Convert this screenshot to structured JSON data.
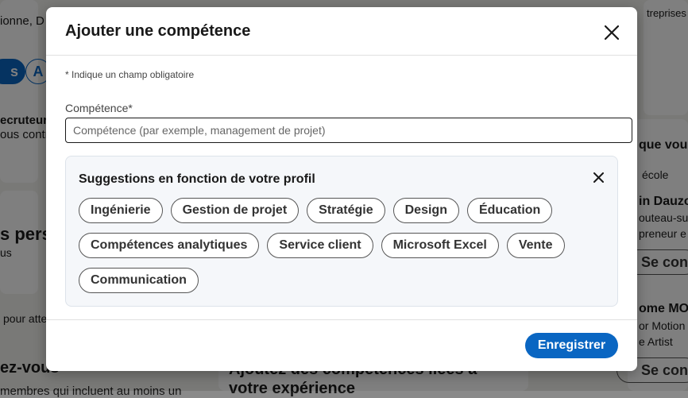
{
  "modal": {
    "title": "Ajouter une compétence",
    "required_note": "* Indique un champ obligatoire",
    "field_label": "Compétence*",
    "field_placeholder": "Compétence (par exemple, management de projet)",
    "field_value": "",
    "suggestions_title": "Suggestions en fonction de votre profil",
    "suggestions": [
      "Ingénierie",
      "Gestion de projet",
      "Stratégie",
      "Design",
      "Éducation",
      "Compétences analytiques",
      "Service client",
      "Microsoft Excel",
      "Vente",
      "Communication"
    ],
    "save_label": "Enregistrer"
  },
  "background": {
    "left_texts": [
      "ionne, D",
      "ecruteurs",
      "ous contr",
      "s perso",
      "us",
      "pour atte",
      "ez-vous"
    ],
    "pill_left_text": "A",
    "pill_left_solid_text": "s",
    "bottom_center_texts": [
      "Ajoutez des compétences liées à",
      "votre expérience"
    ],
    "bottom_left_text": "membres qui incluent au moins un",
    "right_texts": [
      "treprises",
      "que vous",
      "école",
      "in Dauzo",
      "outeau-su",
      "preneur e",
      "Se conn",
      "ome MOX",
      "or Motion",
      "e Artist",
      "Se conn"
    ]
  },
  "colors": {
    "primary": "#0a66c2",
    "overlay": "rgba(0,0,0,0.5)"
  }
}
